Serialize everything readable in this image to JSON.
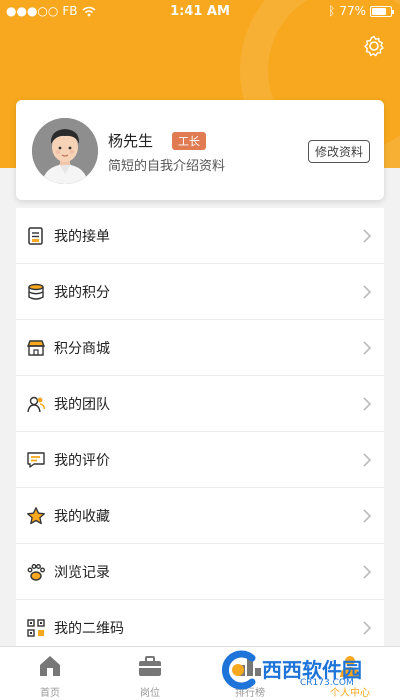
{
  "status_bar": {
    "carrier": "FB",
    "signal_icon": "signal-dots-icon",
    "wifi_icon": "wifi-icon",
    "time": "1:41 AM",
    "bluetooth_icon": "bluetooth-icon",
    "battery": "77%",
    "battery_level": 0.77
  },
  "header": {
    "settings_icon": "gear-icon",
    "accent_color": "#f7a81e"
  },
  "profile": {
    "name": "杨先生",
    "badge": "工长",
    "bio": "简短的自我介绍资料",
    "edit_label": "修改资料",
    "avatar_icon": "user-avatar-icon"
  },
  "menu": [
    {
      "label": "我的接单",
      "icon": "order-list-icon"
    },
    {
      "label": "我的积分",
      "icon": "coin-stack-icon"
    },
    {
      "label": "积分商城",
      "icon": "store-icon"
    },
    {
      "label": "我的团队",
      "icon": "team-icon"
    },
    {
      "label": "我的评价",
      "icon": "comment-icon"
    },
    {
      "label": "我的收藏",
      "icon": "star-icon"
    },
    {
      "label": "浏览记录",
      "icon": "paw-icon"
    },
    {
      "label": "我的二维码",
      "icon": "qr-code-icon"
    }
  ],
  "tabs": [
    {
      "label": "首页",
      "icon": "home-icon"
    },
    {
      "label": "岗位",
      "icon": "briefcase-icon"
    },
    {
      "label": "排行榜",
      "icon": "ranking-icon"
    },
    {
      "label": "个人中心",
      "icon": "person-icon"
    }
  ],
  "watermark": {
    "text": "西西软件园",
    "sub": "CR173.COM"
  }
}
